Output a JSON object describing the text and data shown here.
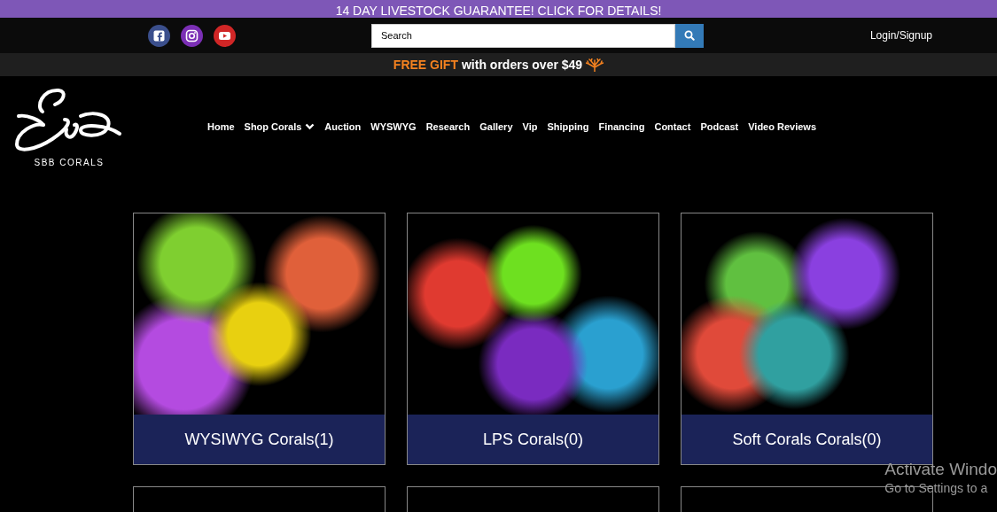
{
  "announcement_bar": {
    "text": "14 DAY LIVESTOCK GUARANTEE! CLICK FOR DETAILS!"
  },
  "header": {
    "search": {
      "placeholder": "Search"
    },
    "login_link": "Login/Signup"
  },
  "promo_bar": {
    "highlight": "FREE GIFT",
    "text": "with orders over $49"
  },
  "logo": {
    "caption": "SBB CORALS"
  },
  "nav": [
    {
      "label": "Home",
      "has_dropdown": false
    },
    {
      "label": "Shop Corals",
      "has_dropdown": true
    },
    {
      "label": "Auction",
      "has_dropdown": false
    },
    {
      "label": "WYSWYG",
      "has_dropdown": false
    },
    {
      "label": "Research",
      "has_dropdown": false
    },
    {
      "label": "Gallery",
      "has_dropdown": false
    },
    {
      "label": "Vip",
      "has_dropdown": false
    },
    {
      "label": "Shipping",
      "has_dropdown": false
    },
    {
      "label": "Financing",
      "has_dropdown": false
    },
    {
      "label": "Contact",
      "has_dropdown": false
    },
    {
      "label": "Podcast",
      "has_dropdown": false
    },
    {
      "label": "Video Reviews",
      "has_dropdown": false
    }
  ],
  "cards": [
    {
      "kind": "category",
      "caption": "WYSIWYG Corals",
      "count": "(1)"
    },
    {
      "kind": "category",
      "caption": "LPS Corals",
      "count": "(0)"
    },
    {
      "kind": "category",
      "caption": "Soft Corals Corals",
      "count": "(0)"
    },
    {
      "kind": "partial"
    },
    {
      "kind": "partial"
    },
    {
      "kind": "partial"
    }
  ],
  "os_overlay": {
    "title": "Activate Windo",
    "subtitle": "Go to Settings to a"
  }
}
